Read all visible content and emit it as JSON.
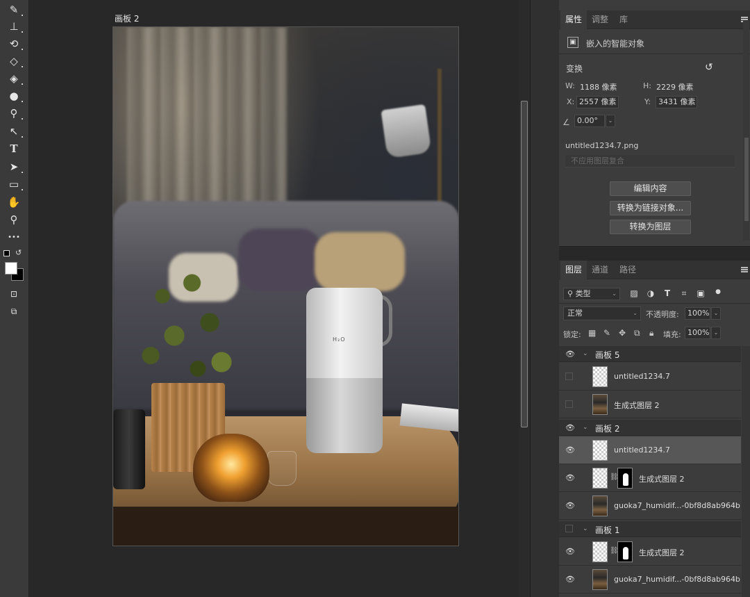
{
  "toolbar": {
    "tools": [
      "brush-icon",
      "stamp-icon",
      "history-brush-icon",
      "eraser-icon",
      "paint-bucket-icon",
      "blur-icon",
      "dodge-icon",
      "pen-icon",
      "type-icon",
      "path-select-icon",
      "rectangle-icon",
      "hand-icon",
      "zoom-icon",
      "more-tools-icon"
    ],
    "type_glyph": "T",
    "more_glyph": "•••"
  },
  "canvas": {
    "artboard_title": "画板 2",
    "product_logo": "H₂O"
  },
  "properties": {
    "tabs": [
      "属性",
      "调整",
      "库"
    ],
    "active_tab": "属性",
    "object_kind": "嵌入的智能对象",
    "transform_title": "变换",
    "w_label": "W:",
    "w_value": "1188 像素",
    "h_label": "H:",
    "h_value": "2229 像素",
    "x_label": "X:",
    "x_value": "2557 像素",
    "y_label": "Y:",
    "y_value": "3431 像素",
    "angle_value": "0.00°",
    "filename": "untitled1234.7.png",
    "layer_comp_placeholder": "不应用图层复合",
    "buttons": [
      "编辑内容",
      "转换为链接对象...",
      "转换为图层"
    ]
  },
  "layers": {
    "tabs": [
      "图层",
      "通道",
      "路径"
    ],
    "active_tab": "图层",
    "filter_label": "类型",
    "blend_mode": "正常",
    "opacity_label": "不透明度:",
    "opacity_value": "100%",
    "lock_label": "锁定:",
    "fill_label": "填充:",
    "fill_value": "100%",
    "groups": [
      {
        "name": "画板 5",
        "visible": true,
        "items": [
          {
            "name": "untitled1234.7",
            "visible": false,
            "selected": false
          },
          {
            "name": "生成式图层 2",
            "visible": false,
            "selected": false
          }
        ]
      },
      {
        "name": "画板 2",
        "visible": true,
        "items": [
          {
            "name": "untitled1234.7",
            "visible": true,
            "selected": true
          },
          {
            "name": "生成式图层 2",
            "visible": true,
            "selected": false
          },
          {
            "name": "guoka7_humidif...-0bf8d8ab964b",
            "visible": true,
            "selected": false
          }
        ]
      },
      {
        "name": "画板 1",
        "visible": false,
        "items": [
          {
            "name": "生成式图层 2",
            "visible": true,
            "selected": false
          },
          {
            "name": "guoka7_humidif...-0bf8d8ab964b",
            "visible": true,
            "selected": false
          }
        ]
      }
    ]
  }
}
